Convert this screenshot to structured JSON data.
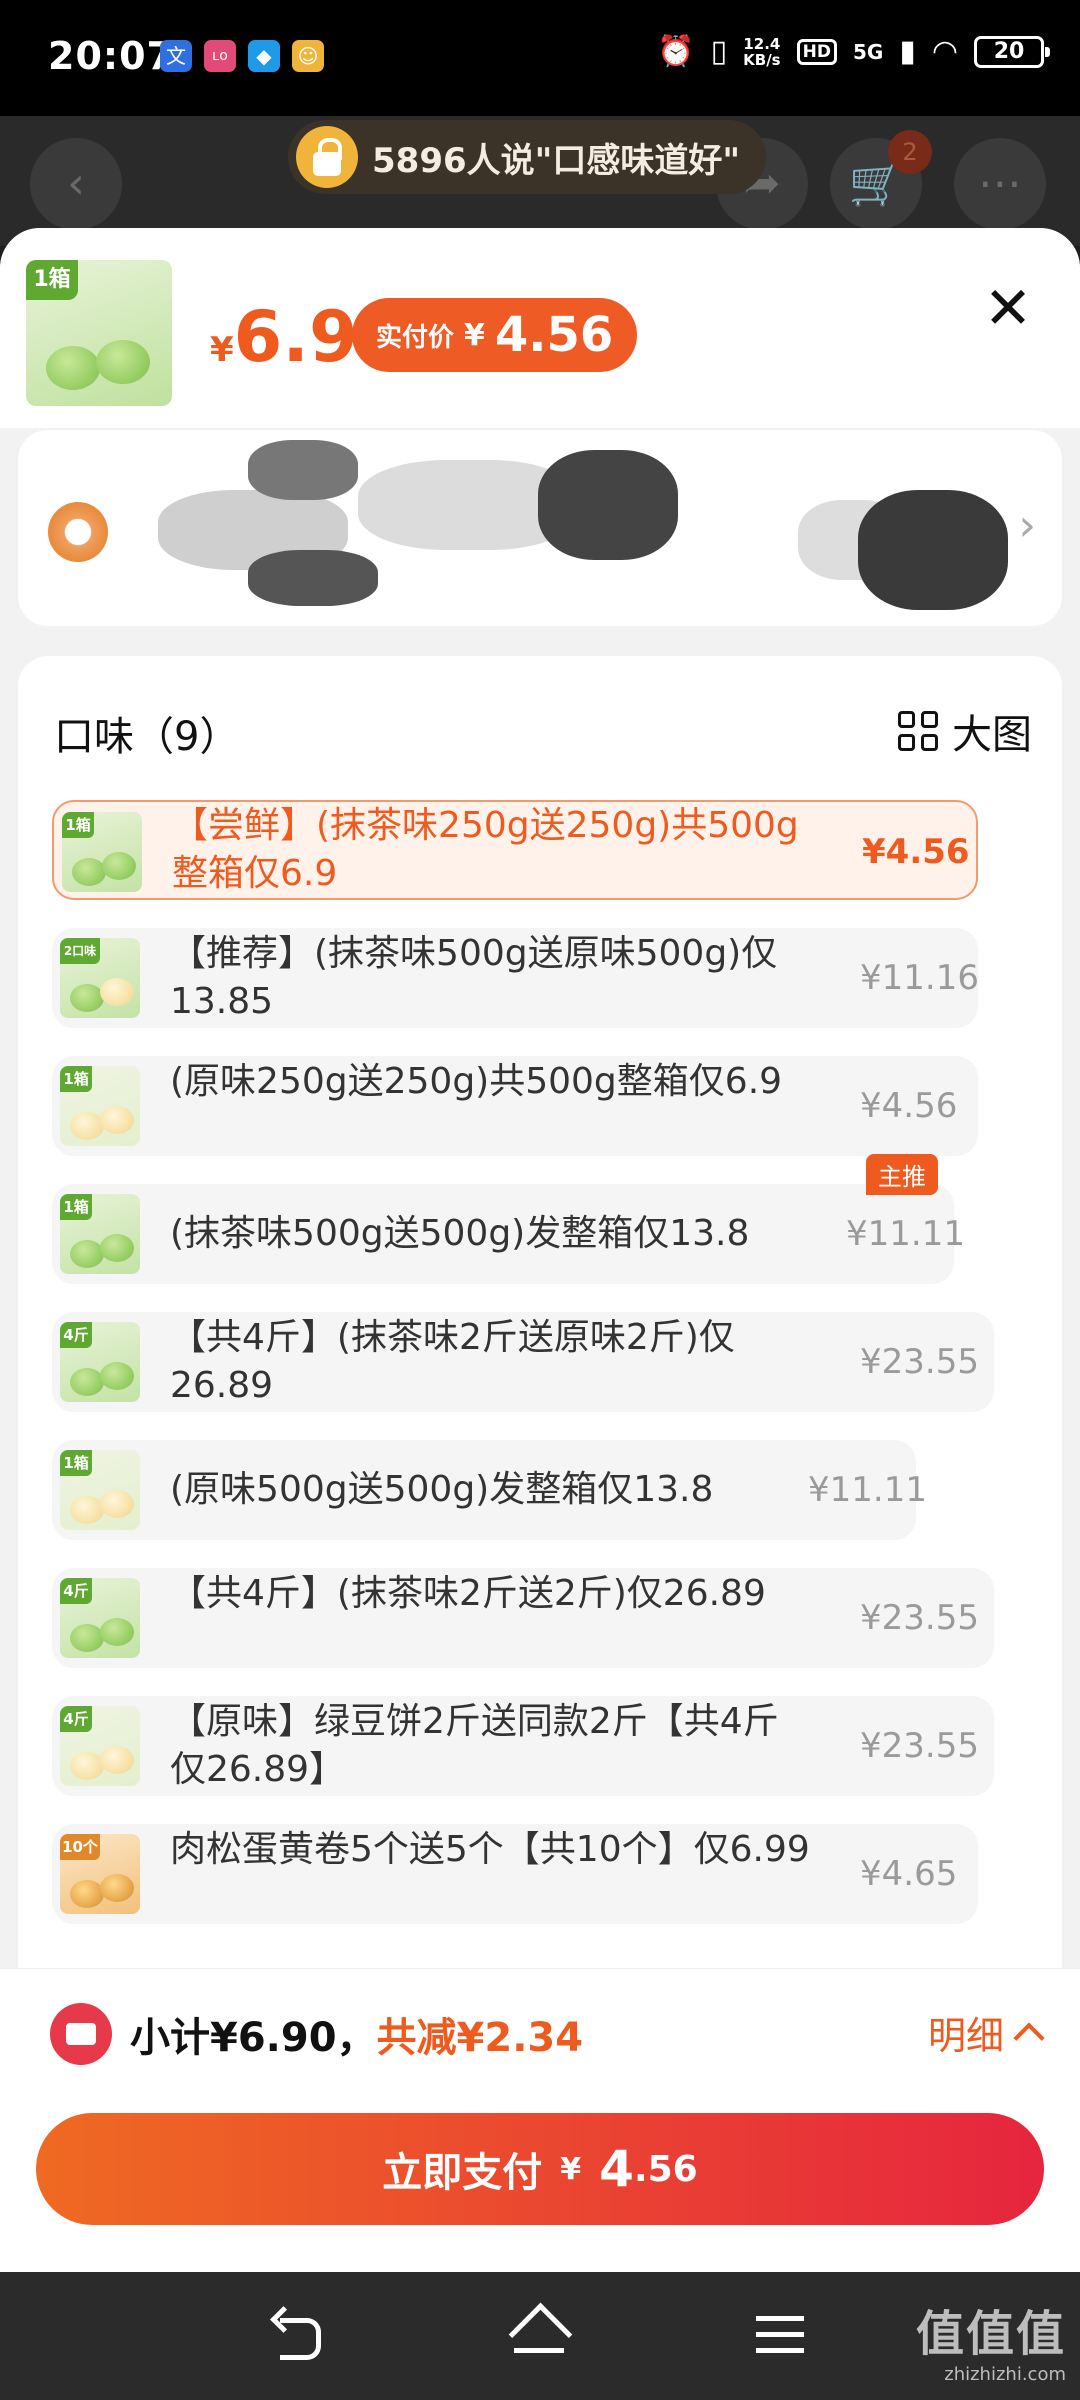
{
  "status_bar": {
    "time": "20:07",
    "app_icons": [
      "文",
      "ʟᴏ",
      "◆",
      "☺"
    ],
    "speed_top": "12.4",
    "speed_unit": "KB/s",
    "hd": "HD",
    "network": "5G",
    "battery": "20"
  },
  "header": {
    "social_proof": "5896人说\"口感味道好\"",
    "cart_count": "2"
  },
  "product": {
    "thumb_tag": "1箱",
    "currency": "¥",
    "price": "6.9",
    "actual_label": "实付价",
    "actual_price": "4.56"
  },
  "flavor_section": {
    "title": "口味（9）",
    "big_view_label": "大图"
  },
  "options": [
    {
      "tag": "1箱",
      "text": "【尝鲜】(抹茶味250g送250g)共500g整箱仅6.9",
      "price": "¥4.56",
      "selected": true
    },
    {
      "tag": "2口味",
      "text": "【推荐】(抹茶味500g送原味500g)仅13.85",
      "price": "¥11.16"
    },
    {
      "tag": "1箱",
      "text": "(原味250g送250g)共500g整箱仅6.9",
      "price": "¥4.56"
    },
    {
      "tag": "1箱",
      "text": "(抹茶味500g送500g)发整箱仅13.8",
      "price": "¥11.11",
      "badge": "主推"
    },
    {
      "tag": "4斤",
      "text": "【共4斤】(抹茶味2斤送原味2斤)仅26.89",
      "price": "¥23.55"
    },
    {
      "tag": "1箱",
      "text": "(原味500g送500g)发整箱仅13.8",
      "price": "¥11.11"
    },
    {
      "tag": "4斤",
      "text": "【共4斤】(抹茶味2斤送2斤)仅26.89",
      "price": "¥23.55"
    },
    {
      "tag": "4斤",
      "text": "【原味】绿豆饼2斤送同款2斤【共4斤仅26.89】",
      "price": "¥23.55"
    },
    {
      "tag": "10个",
      "text": "肉松蛋黄卷5个送5个【共10个】仅6.99",
      "price": "¥4.65"
    }
  ],
  "footer": {
    "subtotal": "小计¥6.90，",
    "discount": "共减¥2.34",
    "detail_label": "明细",
    "pay_label": "立即支付",
    "pay_currency": "¥",
    "pay_int": "4",
    "pay_dec": ".56"
  },
  "watermark": {
    "big": "值值值",
    "small": "zhizhizhi.com"
  },
  "colors": {
    "accent": "#ef5a1f",
    "pay_gradient_start": "#ef6a22",
    "pay_gradient_end": "#e6253e"
  }
}
